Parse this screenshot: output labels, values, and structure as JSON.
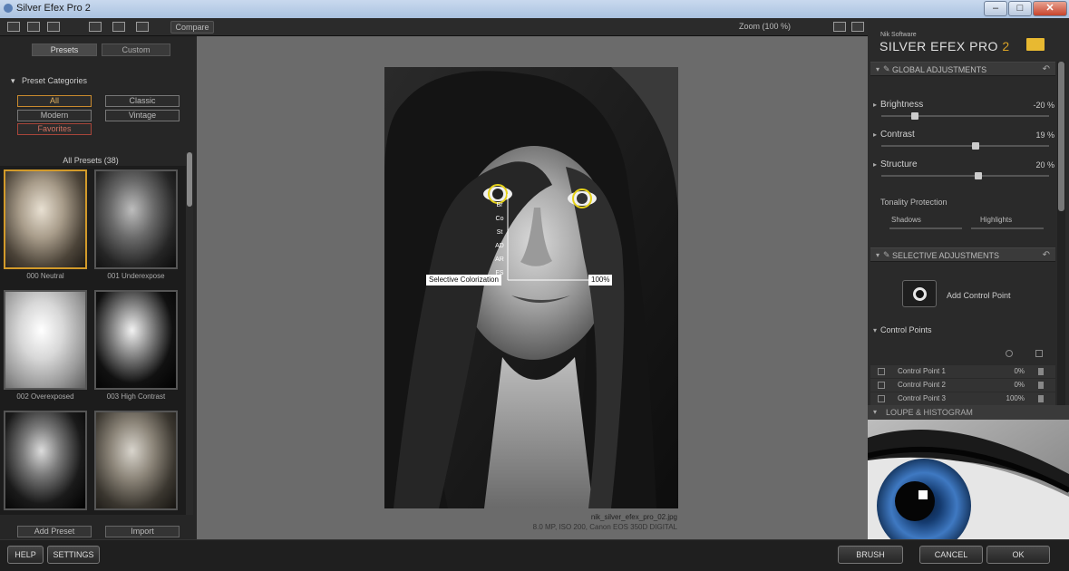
{
  "window": {
    "title": "Silver Efex Pro 2",
    "min": "–",
    "max": "□",
    "close": "✕"
  },
  "toolbar": {
    "compare_label": "Compare",
    "zoom_label": "Zoom (100 %)"
  },
  "left": {
    "tabs": [
      "Presets",
      "Custom"
    ],
    "preset_categories_title": "Preset Categories",
    "categories": [
      "All",
      "Classic",
      "Modern",
      "Vintage",
      "Favorites"
    ],
    "all_presets_label": "All Presets (38)",
    "presets": [
      "000 Neutral",
      "001 Underexpose",
      "002 Overexposed",
      "003 High Contrast",
      "",
      ""
    ],
    "add_preset_label": "Add Preset",
    "import_label": "Import"
  },
  "center": {
    "file_name": "nik_silver_efex_pro_02.jpg",
    "file_info": "8.0 MP, ISO 200, Canon EOS 350D DIGITAL",
    "selective_coloration_label": "Selective Colorization",
    "cp_pct": "100%",
    "cp_sliders": [
      "Br",
      "Co",
      "St",
      "AD",
      "AR",
      "FS"
    ]
  },
  "right": {
    "brand_small": "Nik Software",
    "brand_main": "SILVER EFEX PRO",
    "brand_num": "2",
    "global_title": "GLOBAL ADJUSTMENTS",
    "adjustments": [
      {
        "label": "Brightness",
        "value": "-20 %",
        "knob": 0.2
      },
      {
        "label": "Contrast",
        "value": "19 %",
        "knob": 0.56
      },
      {
        "label": "Structure",
        "value": "20 %",
        "knob": 0.58
      }
    ],
    "tonality_title": "Tonality Protection",
    "shadows_label": "Shadows",
    "highlights_label": "Highlights",
    "selective_title": "SELECTIVE ADJUSTMENTS",
    "add_cp_label": "Add Control Point",
    "control_points_title": "Control Points",
    "control_points": [
      {
        "name": "Control Point 1",
        "pct": "0%"
      },
      {
        "name": "Control Point 2",
        "pct": "0%"
      },
      {
        "name": "Control Point 3",
        "pct": "100%"
      }
    ],
    "loupe_title": "LOUPE & HISTOGRAM"
  },
  "bottom": {
    "help": "HELP",
    "settings": "SETTINGS",
    "brush": "BRUSH",
    "cancel": "CANCEL",
    "ok": "OK"
  }
}
